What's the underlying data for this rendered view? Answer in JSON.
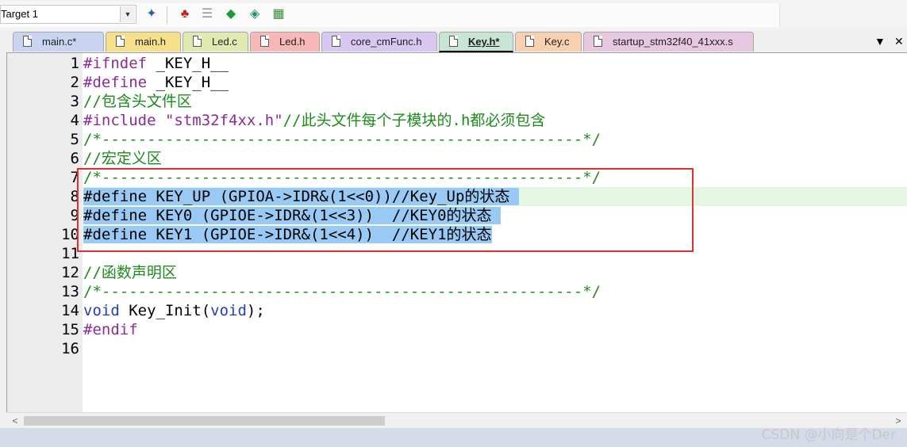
{
  "toolbar": {
    "target": "Target 1",
    "icons": [
      "dropdown-arrow-icon",
      "magic-wand-icon",
      "manage-components-icon",
      "layers-icon",
      "green-diamond-icon",
      "pack-installer-icon",
      "select-packs-icon"
    ]
  },
  "tabs": [
    {
      "label": "main.c*",
      "color": "#c9d4f0"
    },
    {
      "label": "main.h",
      "color": "#f7e08a"
    },
    {
      "label": "Led.c",
      "color": "#dfe9b0"
    },
    {
      "label": "Led.h",
      "color": "#f7b8b8"
    },
    {
      "label": "core_cmFunc.h",
      "color": "#d8c8f0"
    },
    {
      "label": "Key.h*",
      "color": "#c8e4d4",
      "active": true
    },
    {
      "label": "Key.c",
      "color": "#f8d2b0"
    },
    {
      "label": "startup_stm32f40_41xxx.s",
      "color": "#e8c8e0"
    }
  ],
  "tab_controls": {
    "menu": "▼",
    "close": "✕"
  },
  "code": {
    "lines": [
      {
        "n": "1",
        "segs": [
          {
            "t": "#ifndef",
            "c": "pre"
          },
          {
            "t": " _KEY_H__",
            "c": "id"
          }
        ]
      },
      {
        "n": "2",
        "segs": [
          {
            "t": "#define",
            "c": "pre"
          },
          {
            "t": " _KEY_H__",
            "c": "id"
          }
        ]
      },
      {
        "n": "3",
        "segs": [
          {
            "t": "//包含头文件区",
            "c": "com"
          }
        ]
      },
      {
        "n": "4",
        "segs": [
          {
            "t": "#include",
            "c": "pre"
          },
          {
            "t": " \"stm32f4xx.h\"",
            "c": "str"
          },
          {
            "t": "//此头文件每个子模块的.h都必须包含",
            "c": "com"
          }
        ]
      },
      {
        "n": "5",
        "segs": [
          {
            "t": "/*-----------------------------------------------------*/",
            "c": "com"
          }
        ]
      },
      {
        "n": "6",
        "segs": [
          {
            "t": "//宏定义区",
            "c": "com"
          }
        ]
      },
      {
        "n": "7",
        "segs": [
          {
            "t": "/*-----------------------------------------------------*/",
            "c": "com"
          }
        ]
      },
      {
        "n": "8",
        "segs": [
          {
            "t": "#define KEY_UP (GPIOA->IDR&(1<<0))//Key_Up的状态 ",
            "c": "sel"
          }
        ]
      },
      {
        "n": "9",
        "segs": [
          {
            "t": "#define KEY0 (GPIOE->IDR&(1<<3))  //KEY0的状态 ",
            "c": "sel"
          }
        ]
      },
      {
        "n": "10",
        "segs": [
          {
            "t": "#define KEY1 (GPIOE->IDR&(1<<4))  //KEY1的状态",
            "c": "sel"
          }
        ]
      },
      {
        "n": "11",
        "segs": []
      },
      {
        "n": "12",
        "segs": [
          {
            "t": "//函数声明区",
            "c": "com"
          }
        ]
      },
      {
        "n": "13",
        "segs": [
          {
            "t": "/*-----------------------------------------------------*/",
            "c": "com"
          }
        ]
      },
      {
        "n": "14",
        "segs": [
          {
            "t": "void",
            "c": "kw"
          },
          {
            "t": " Key_Init(",
            "c": "id"
          },
          {
            "t": "void",
            "c": "kw"
          },
          {
            "t": ");",
            "c": "id"
          }
        ]
      },
      {
        "n": "15",
        "segs": [
          {
            "t": "#endif",
            "c": "pre"
          }
        ]
      },
      {
        "n": "16",
        "segs": []
      }
    ]
  },
  "scrollbar": {
    "left_arrow": "<",
    "right_arrow": ">"
  },
  "watermark": "CSDN @小向是个Der"
}
